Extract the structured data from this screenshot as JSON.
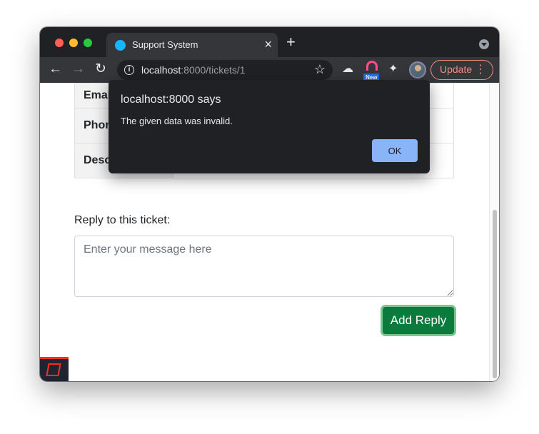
{
  "browser": {
    "tab": {
      "title": "Support System",
      "close_glyph": "×"
    },
    "new_tab_glyph": "+",
    "url_host": "localhost",
    "url_path": ":8000/tickets/1",
    "update_label": "Update",
    "new_badge": "New"
  },
  "ticket_table": {
    "rows": [
      {
        "label": "Emai",
        "value": ""
      },
      {
        "label": "Phon",
        "value": ""
      },
      {
        "label": "Desc",
        "value": ""
      }
    ]
  },
  "reply": {
    "label": "Reply to this ticket:",
    "placeholder": "Enter your message here",
    "value": "",
    "submit_label": "Add Reply"
  },
  "dialog": {
    "title": "localhost:8000 says",
    "message": "The given data was invalid.",
    "ok_label": "OK"
  },
  "colors": {
    "submit_button": "#0a7a3d",
    "dialog_button": "#8ab4f8",
    "tab_favicon": "#19b5fe",
    "update_accent": "#f28b82"
  },
  "icons": [
    "back-arrow-icon",
    "forward-arrow-icon",
    "reload-icon",
    "info-icon",
    "star-icon",
    "extension-icon",
    "puzzle-icon",
    "kebab-menu-icon",
    "laravel-icon"
  ]
}
